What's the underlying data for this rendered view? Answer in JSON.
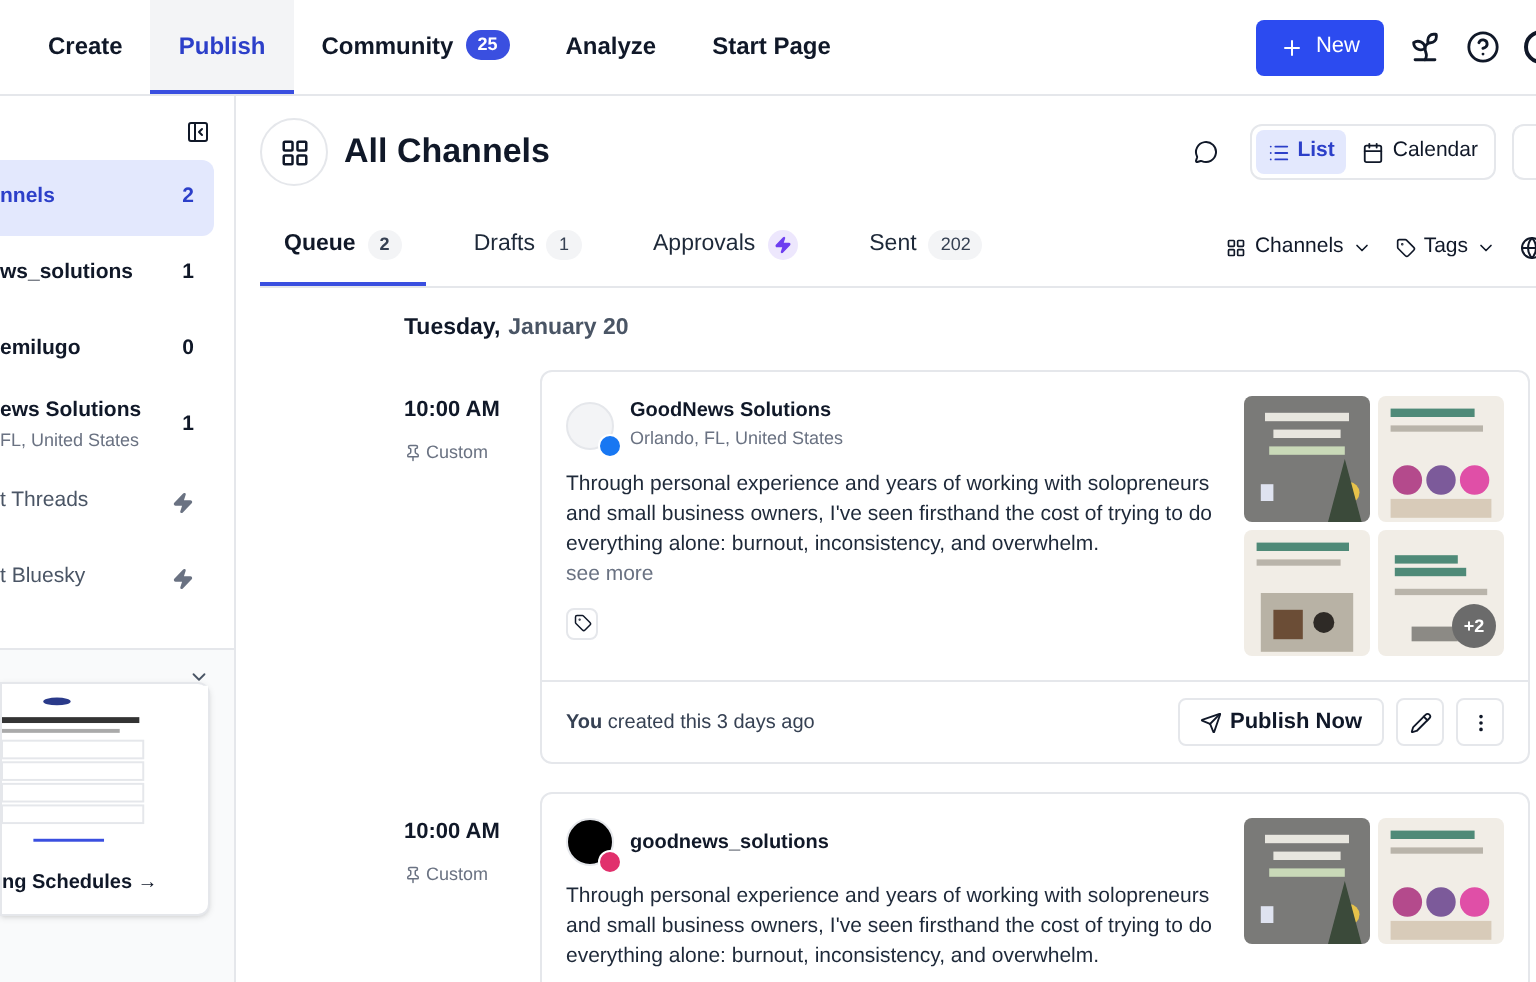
{
  "nav": {
    "tabs": [
      {
        "label": "Create",
        "selected": false
      },
      {
        "label": "Publish",
        "selected": true
      },
      {
        "label": "Community",
        "badge": "25",
        "selected": false
      },
      {
        "label": "Analyze",
        "selected": false
      },
      {
        "label": "Start Page",
        "selected": false
      }
    ],
    "new_button": "New"
  },
  "sidebar": {
    "channels": [
      {
        "kind": "channel",
        "name": "nnels",
        "count": "2",
        "selected": true
      },
      {
        "kind": "channel",
        "name": "ws_solutions",
        "count": "1",
        "selected": false
      },
      {
        "kind": "channel",
        "name": "emilugo",
        "count": "0",
        "selected": false
      },
      {
        "kind": "channel",
        "name": "ews Solutions",
        "subtitle": "FL, United States",
        "count": "1",
        "selected": false
      },
      {
        "kind": "connect",
        "name": "t Threads",
        "selected": false
      },
      {
        "kind": "connect",
        "name": "t Bluesky",
        "selected": false
      }
    ],
    "promo": {
      "link": "ng Schedules →"
    }
  },
  "header": {
    "title": "All Channels",
    "views": [
      {
        "label": "List",
        "selected": true
      },
      {
        "label": "Calendar",
        "selected": false
      }
    ]
  },
  "tabs": [
    {
      "label": "Queue",
      "badge": "2",
      "selected": true
    },
    {
      "label": "Drafts",
      "badge": "1",
      "selected": false
    },
    {
      "label": "Approvals",
      "kind": "bolt",
      "selected": false
    },
    {
      "label": "Sent",
      "badge": "202",
      "selected": false
    }
  ],
  "filters": [
    {
      "label": "Channels",
      "kind": "grid"
    },
    {
      "label": "Tags",
      "kind": "tag"
    }
  ],
  "day": {
    "weekday": "Tuesday,",
    "date": "January 20"
  },
  "posts": [
    {
      "time": "10:00 AM",
      "schedule": "Custom",
      "kind": "facebook",
      "name": "GoodNews Solutions",
      "location": "Orlando, FL, United States",
      "text": "Through personal experience and years of working with solopreneurs and small business owners, I've seen firsthand the cost of trying to do everything alone: burnout, inconsistency, and overwhelm.",
      "see_more": "see more",
      "more_images": "+2",
      "footer": "**You** created this 3 days ago",
      "publish": "Publish Now"
    },
    {
      "time": "10:00 AM",
      "schedule": "Custom",
      "kind": "instagram",
      "name": "goodnews_solutions",
      "text": "Through personal experience and years of working with solopreneurs and small business owners, I've seen firsthand the cost of trying to do everything alone: burnout, inconsistency, and overwhelm."
    }
  ]
}
